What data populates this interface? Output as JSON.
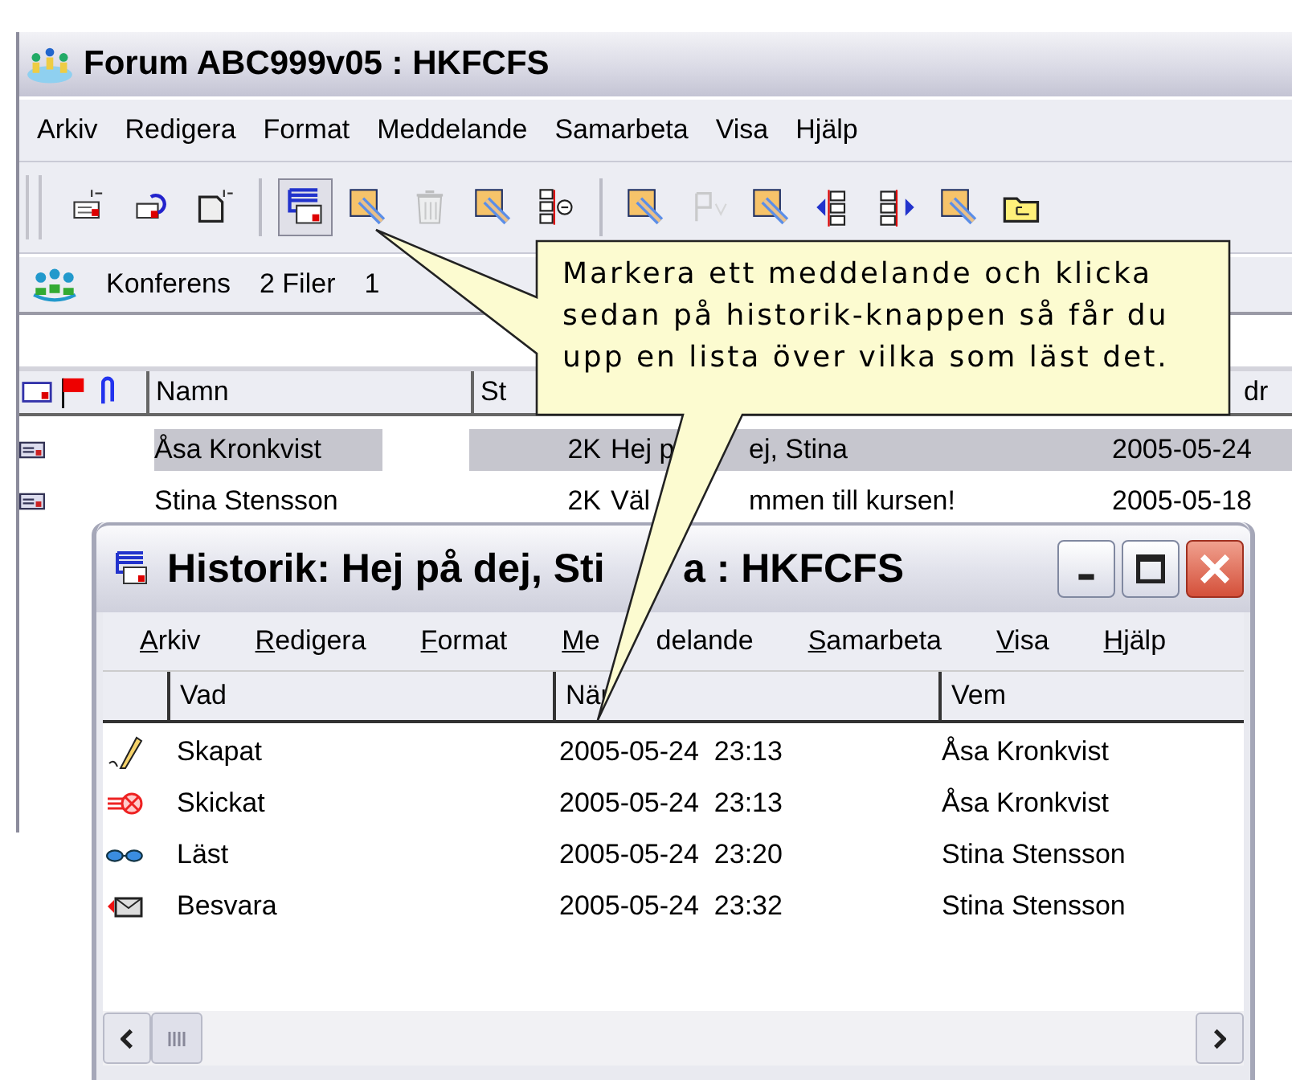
{
  "main_window": {
    "title": "Forum ABC999v05 : HKFCFS",
    "menu": [
      "Arkiv",
      "Redigera",
      "Format",
      "Meddelande",
      "Samarbeta",
      "Visa",
      "Hjälp"
    ],
    "toolbar_groups": [
      [
        {
          "kind": "new-message",
          "pressed": false,
          "disabled": false
        },
        {
          "kind": "reply",
          "pressed": false,
          "disabled": false
        },
        {
          "kind": "new-document",
          "pressed": false,
          "disabled": false
        }
      ],
      [
        {
          "kind": "history",
          "pressed": true,
          "disabled": false
        },
        {
          "kind": "edit",
          "pressed": false,
          "disabled": false
        },
        {
          "kind": "delete",
          "pressed": false,
          "disabled": true
        },
        {
          "kind": "edit",
          "pressed": false,
          "disabled": false
        },
        {
          "kind": "tree",
          "pressed": false,
          "disabled": false
        }
      ],
      [
        {
          "kind": "edit",
          "pressed": false,
          "disabled": false
        },
        {
          "kind": "flag",
          "pressed": false,
          "disabled": true
        },
        {
          "kind": "edit",
          "pressed": false,
          "disabled": false
        },
        {
          "kind": "previous",
          "pressed": false,
          "disabled": false
        },
        {
          "kind": "next",
          "pressed": false,
          "disabled": false
        },
        {
          "kind": "edit",
          "pressed": false,
          "disabled": false
        },
        {
          "kind": "folder",
          "pressed": false,
          "disabled": false
        }
      ]
    ],
    "conference_bar": [
      "Konferens",
      "2 Filer",
      "1"
    ],
    "columns": [
      "Namn",
      "St",
      "dr"
    ],
    "rows": [
      {
        "selected": true,
        "name": "Åsa Kronkvist",
        "size": "2K",
        "subject": [
          "Hej p",
          "ej, Stina"
        ],
        "date": "2005-05-24"
      },
      {
        "selected": false,
        "name": "Stina Stensson",
        "size": "2K",
        "subject": [
          "Väl",
          "mmen till kursen!"
        ],
        "date": "2005-05-18"
      }
    ]
  },
  "callout": {
    "text": "Markera ett meddelande och klicka sedan på historik-knappen så får du upp en lista över vilka som läst det."
  },
  "history_window": {
    "title": [
      "Historik: Hej på dej, Sti",
      "a : HKFCFS"
    ],
    "menu": [
      {
        "label": "Arkiv",
        "continuation": false
      },
      {
        "label": "Redigera",
        "continuation": false
      },
      {
        "label": "Format",
        "continuation": false
      },
      {
        "label": "Me",
        "continuation": false
      },
      {
        "label": "delande",
        "continuation": true
      },
      {
        "label": "Samarbeta",
        "continuation": false
      },
      {
        "label": "Visa",
        "continuation": false
      },
      {
        "label": "Hjälp",
        "continuation": false
      }
    ],
    "columns": [
      "Vad",
      "När",
      "Vem"
    ],
    "rows": [
      {
        "kind": "created",
        "action": "Skapat",
        "when": "2005-05-24  23:13",
        "who": "Åsa Kronkvist"
      },
      {
        "kind": "sent",
        "action": "Skickat",
        "when": "2005-05-24  23:13",
        "who": "Åsa Kronkvist"
      },
      {
        "kind": "read",
        "action": "Läst",
        "when": "2005-05-24  23:20",
        "who": "Stina Stensson"
      },
      {
        "kind": "replied",
        "action": "Besvara",
        "when": "2005-05-24  23:32",
        "who": "Stina Stensson"
      }
    ]
  }
}
